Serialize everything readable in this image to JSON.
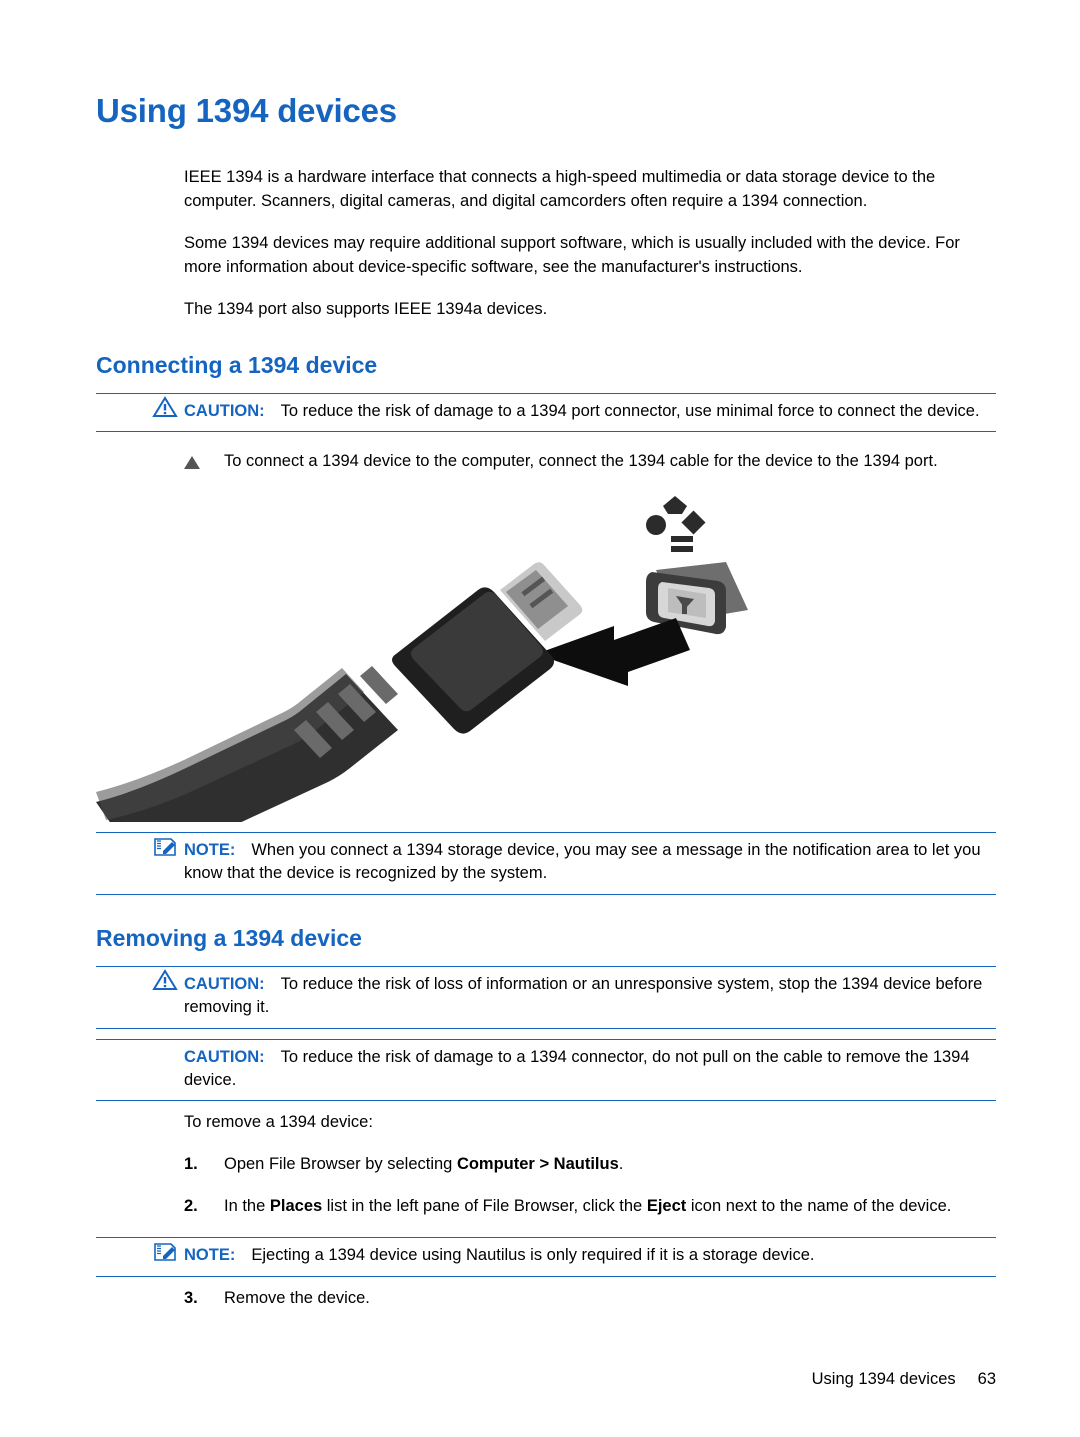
{
  "document": {
    "title": "Using 1394 devices",
    "intro_paragraphs": [
      "IEEE 1394 is a hardware interface that connects a high-speed multimedia or data storage device to the computer. Scanners, digital cameras, and digital camcorders often require a 1394 connection.",
      "Some 1394 devices may require additional support software, which is usually included with the device. For more information about device-specific software, see the manufacturer's instructions.",
      "The 1394 port also supports IEEE 1394a devices."
    ],
    "section_connecting": {
      "heading": "Connecting a 1394 device",
      "caution_label": "CAUTION:",
      "caution_text": "To reduce the risk of damage to a 1394 port connector, use minimal force to connect the device.",
      "bullet_text": "To connect a 1394 device to the computer, connect the 1394 cable for the device to the 1394 port.",
      "note_label": "NOTE:",
      "note_text": "When you connect a 1394 storage device, you may see a message in the notification area to let you know that the device is recognized by the system."
    },
    "section_removing": {
      "heading": "Removing a 1394 device",
      "caution1_label": "CAUTION:",
      "caution1_text": "To reduce the risk of loss of information or an unresponsive system, stop the 1394 device before removing it.",
      "caution2_label": "CAUTION:",
      "caution2_text": "To reduce the risk of damage to a 1394 connector, do not pull on the cable to remove the 1394 device.",
      "lead_in": "To remove a 1394 device:",
      "steps": [
        {
          "number": "1.",
          "text_before": "Open File Browser by selecting ",
          "bold": "Computer > Nautilus",
          "text_after": "."
        },
        {
          "number": "2.",
          "text_before": "In the ",
          "bold": "Places",
          "text_mid": " list in the left pane of File Browser, click the ",
          "bold2": "Eject",
          "text_after": " icon next to the name of the device."
        },
        {
          "number": "3.",
          "text_before": "Remove the device.",
          "bold": "",
          "text_after": ""
        }
      ],
      "note_label": "NOTE:",
      "note_text": "Ejecting a 1394 device using Nautilus is only required if it is a storage device."
    },
    "figure": {
      "alt": "Illustration of a 1394 cable connector being inserted into a 1394 port on the computer",
      "arrow": "insertion-arrow"
    },
    "footer": {
      "running_title": "Using 1394 devices",
      "page_number": "63"
    },
    "colors": {
      "heading_blue": "#1565c0",
      "rule_blue": "#1565c0",
      "text_black": "#000000"
    }
  }
}
